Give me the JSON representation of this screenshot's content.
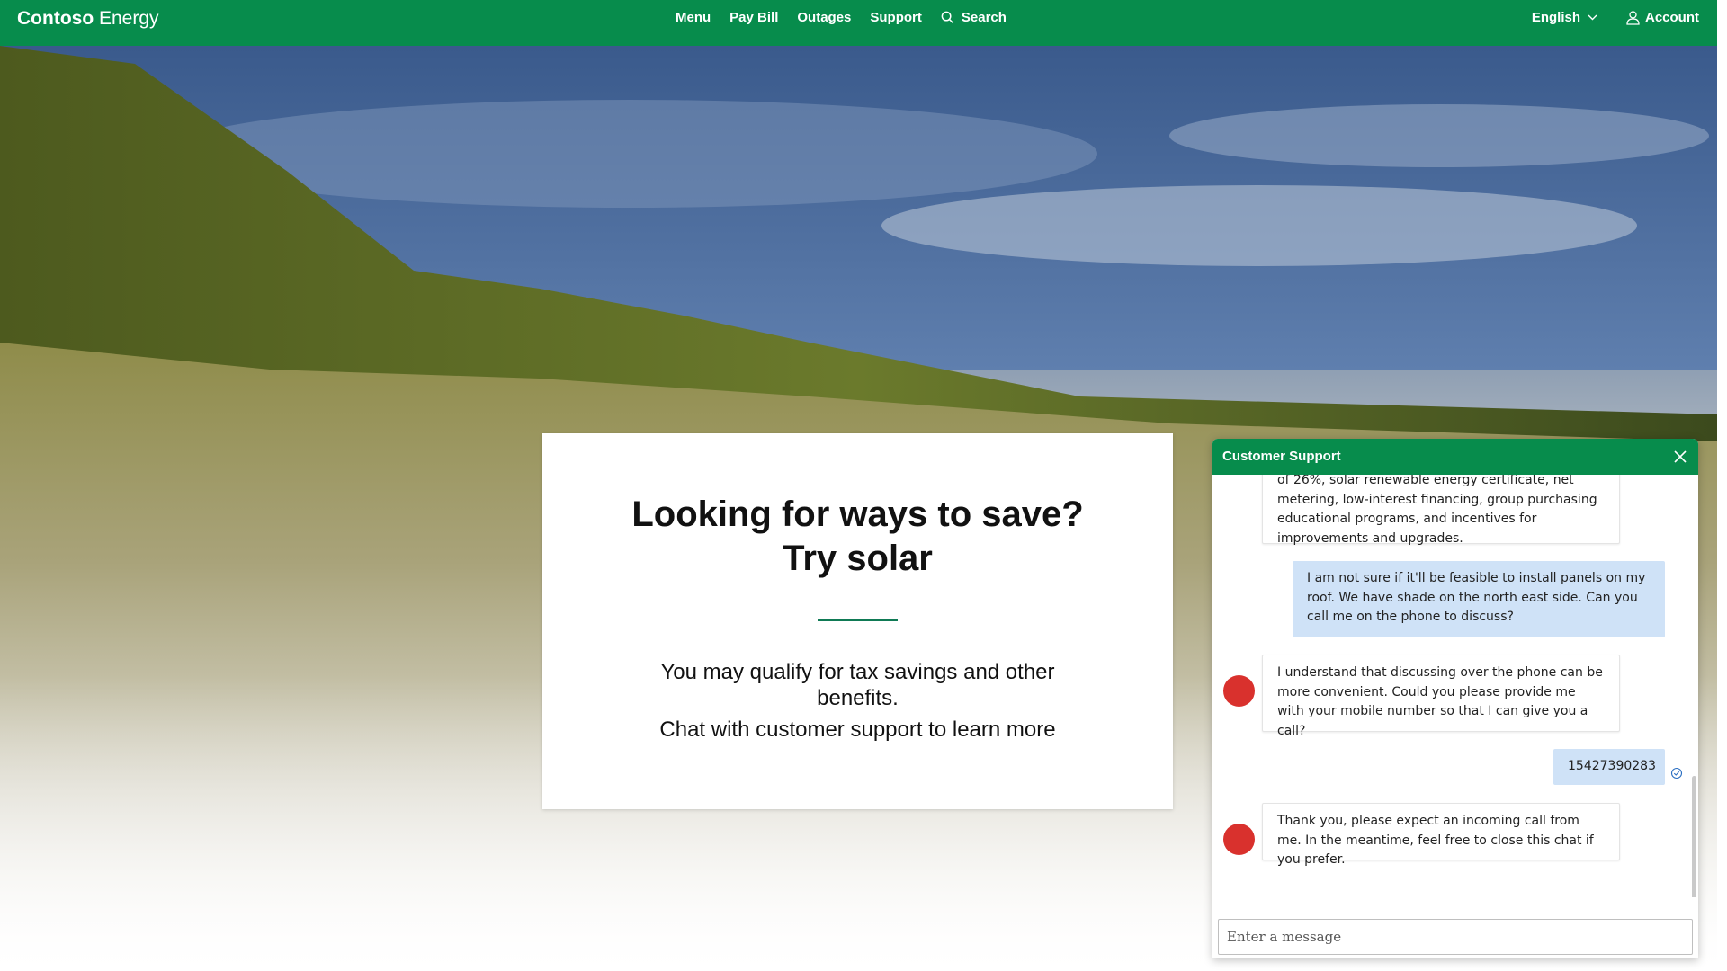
{
  "brand": {
    "bold": "Contoso",
    "light": "Energy"
  },
  "nav": {
    "menu": "Menu",
    "pay_bill": "Pay Bill",
    "outages": "Outages",
    "support": "Support",
    "search": "Search",
    "language": "English",
    "account": "Account"
  },
  "promo": {
    "title_line1": "Looking for ways to save?",
    "title_line2": "Try solar",
    "text": "You may qualify for tax savings and other benefits.",
    "text2": "Chat with customer support to learn more"
  },
  "chat": {
    "title": "Customer Support",
    "messages": [
      {
        "from": "bot",
        "text": "of 26%, solar renewable energy certificate, net metering, low-interest financing, group purchasing educational programs, and incentives for improvements and upgrades."
      },
      {
        "from": "user",
        "text": "I am not sure if it'll be feasible to install panels on my roof. We have shade on the north east side. Can you call me on the phone to discuss?"
      },
      {
        "from": "bot",
        "text": "I understand that discussing over the phone can be more convenient. Could you please provide me with your mobile number so that I can give you a call?"
      },
      {
        "from": "user",
        "text": "15427390283"
      },
      {
        "from": "bot",
        "text": "Thank you, please expect an incoming call from me. In the meantime, feel free to close this chat if you prefer."
      }
    ],
    "input_placeholder": "Enter a message"
  },
  "colors": {
    "brand_green": "#078c4c",
    "user_bubble": "#cfe2f7",
    "bot_avatar": "#d9312d"
  }
}
